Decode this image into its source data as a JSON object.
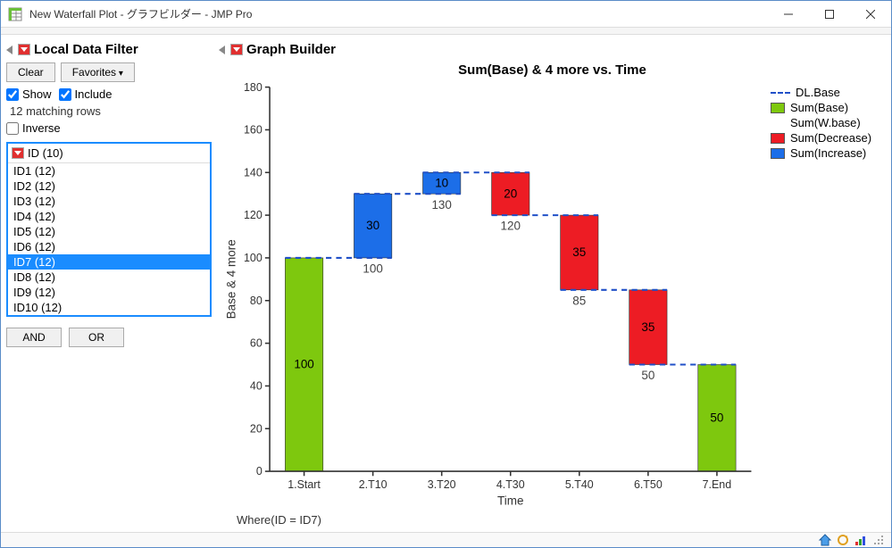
{
  "window": {
    "title": "New Waterfall Plot - グラフビルダー - JMP Pro"
  },
  "left_panel": {
    "header": "Local Data Filter",
    "clear_label": "Clear",
    "favorites_label": "Favorites",
    "show_label": "Show",
    "include_label": "Include",
    "matching_text": "12 matching rows",
    "inverse_label": "Inverse",
    "filter_header": "ID (10)",
    "items": [
      {
        "label": "ID1 (12)",
        "selected": false
      },
      {
        "label": "ID2 (12)",
        "selected": false
      },
      {
        "label": "ID3 (12)",
        "selected": false
      },
      {
        "label": "ID4 (12)",
        "selected": false
      },
      {
        "label": "ID5 (12)",
        "selected": false
      },
      {
        "label": "ID6 (12)",
        "selected": false
      },
      {
        "label": "ID7 (12)",
        "selected": true
      },
      {
        "label": "ID8 (12)",
        "selected": false
      },
      {
        "label": "ID9 (12)",
        "selected": false
      },
      {
        "label": "ID10 (12)",
        "selected": false
      }
    ],
    "and_label": "AND",
    "or_label": "OR"
  },
  "right_panel": {
    "header": "Graph Builder",
    "chart_title": "Sum(Base) & 4 more vs. Time",
    "ylabel": "Base & 4 more",
    "xlabel": "Time",
    "where_clause": "Where(ID = ID7)",
    "legend": {
      "dlbase": "DL.Base",
      "sumbase": "Sum(Base)",
      "sumwbase": "Sum(W.base)",
      "sumdecrease": "Sum(Decrease)",
      "sumincrease": "Sum(Increase)"
    },
    "colors": {
      "base": "#7ec80e",
      "decrease": "#ed1c24",
      "increase": "#1c6ee8",
      "dash": "#2050c8"
    }
  },
  "chart_data": {
    "type": "bar",
    "title": "Sum(Base) & 4 more vs. Time",
    "xlabel": "Time",
    "ylabel": "Base & 4 more",
    "ylim": [
      0,
      180
    ],
    "yticks": [
      0,
      20,
      40,
      60,
      80,
      100,
      120,
      140,
      160,
      180
    ],
    "categories": [
      "1.Start",
      "2.T10",
      "3.T20",
      "4.T30",
      "5.T40",
      "6.T50",
      "7.End"
    ],
    "waterfall": [
      {
        "x": "1.Start",
        "type": "base",
        "bottom": 0,
        "top": 100,
        "label": 100,
        "wbase": null
      },
      {
        "x": "2.T10",
        "type": "increase",
        "bottom": 100,
        "top": 130,
        "label": 30,
        "wbase": 100
      },
      {
        "x": "3.T20",
        "type": "increase",
        "bottom": 130,
        "top": 140,
        "label": 10,
        "wbase": 130
      },
      {
        "x": "4.T30",
        "type": "decrease",
        "bottom": 120,
        "top": 140,
        "label": 20,
        "wbase": 120
      },
      {
        "x": "5.T40",
        "type": "decrease",
        "bottom": 85,
        "top": 120,
        "label": 35,
        "wbase": 85
      },
      {
        "x": "6.T50",
        "type": "decrease",
        "bottom": 50,
        "top": 85,
        "label": 35,
        "wbase": 50
      },
      {
        "x": "7.End",
        "type": "base",
        "bottom": 0,
        "top": 50,
        "label": 50,
        "wbase": null
      }
    ],
    "connectors": [
      {
        "from_x": "1.Start",
        "to_x": "2.T10",
        "y": 100
      },
      {
        "from_x": "2.T10",
        "to_x": "3.T20",
        "y": 130
      },
      {
        "from_x": "3.T20",
        "to_x": "4.T30",
        "y": 140
      },
      {
        "from_x": "4.T30",
        "to_x": "5.T40",
        "y": 120
      },
      {
        "from_x": "5.T40",
        "to_x": "6.T50",
        "y": 85
      },
      {
        "from_x": "6.T50",
        "to_x": "7.End",
        "y": 50
      }
    ]
  }
}
